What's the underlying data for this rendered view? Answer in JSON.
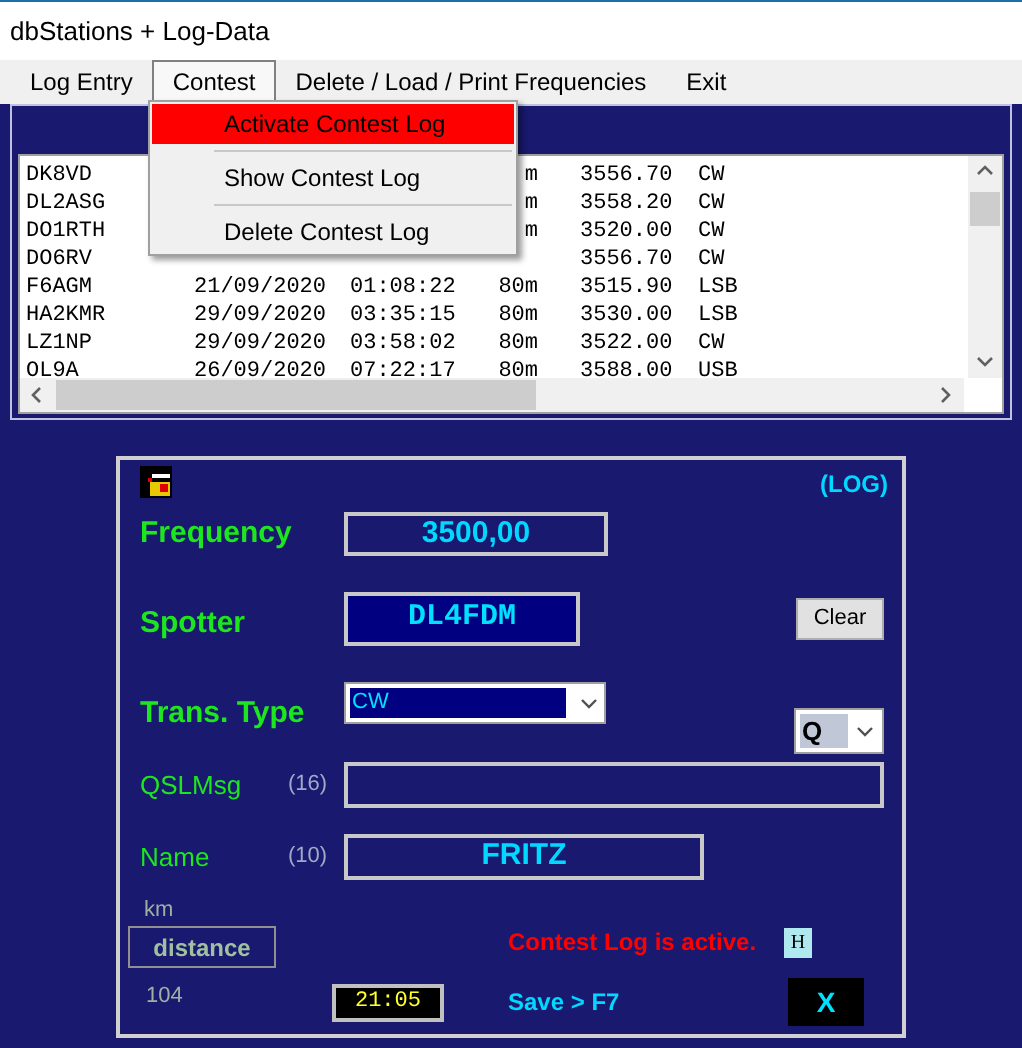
{
  "window": {
    "title": "dbStations + Log-Data"
  },
  "menu_bar": [
    {
      "label": "Log Entry",
      "selected": false
    },
    {
      "label": "Contest",
      "selected": true
    },
    {
      "label": "Delete / Load / Print Frequencies",
      "selected": false
    },
    {
      "label": "Exit",
      "selected": false
    }
  ],
  "dropdown": {
    "items": [
      {
        "label": "Activate Contest Log",
        "selected": true
      },
      {
        "label": "Show Contest Log",
        "selected": false
      },
      {
        "label": "Delete Contest Log",
        "selected": false
      }
    ]
  },
  "stations": {
    "rows": [
      {
        "call": "DK8VD",
        "band": "m",
        "freq": "3556.70",
        "mode": "CW"
      },
      {
        "call": "DL2ASG",
        "band": "m",
        "freq": "3558.20",
        "mode": "CW"
      },
      {
        "call": "DO1RTH",
        "band": "m",
        "freq": "3520.00",
        "mode": "CW"
      },
      {
        "call": "DO6RV",
        "freq": "3556.70",
        "mode": "CW"
      },
      {
        "call": "F6AGM",
        "date": "21/09/2020",
        "time": "01:08:22",
        "band": "80m",
        "freq": "3515.90",
        "mode": "LSB"
      },
      {
        "call": "HA2KMR",
        "date": "29/09/2020",
        "time": "03:35:15",
        "band": "80m",
        "freq": "3530.00",
        "mode": "LSB"
      },
      {
        "call": "LZ1NP",
        "date": "29/09/2020",
        "time": "03:58:02",
        "band": "80m",
        "freq": "3522.00",
        "mode": "CW"
      },
      {
        "call": "OL9A",
        "date": "26/09/2020",
        "time": "07:22:17",
        "band": "80m",
        "freq": "3588.00",
        "mode": "USB"
      }
    ]
  },
  "form": {
    "mode_label": "(LOG)",
    "frequency": {
      "label": "Frequency",
      "value": "3500,00"
    },
    "spotter": {
      "label": "Spotter",
      "value": "DL4FDM"
    },
    "clear_button": "Clear",
    "trans_type": {
      "label": "Trans. Type",
      "value": "CW"
    },
    "q_select": {
      "value": "Q"
    },
    "qsl_msg": {
      "label": "QSLMsg",
      "max": "(16)"
    },
    "name": {
      "label": "Name",
      "max": "(10)",
      "value": "FRITZ"
    },
    "distance": {
      "unit": "km",
      "button": "distance",
      "value": "104"
    },
    "status": "Contest Log is active.",
    "h_button": "H",
    "time": "21:05",
    "save_hint": "Save > F7",
    "close_button": "X"
  }
}
